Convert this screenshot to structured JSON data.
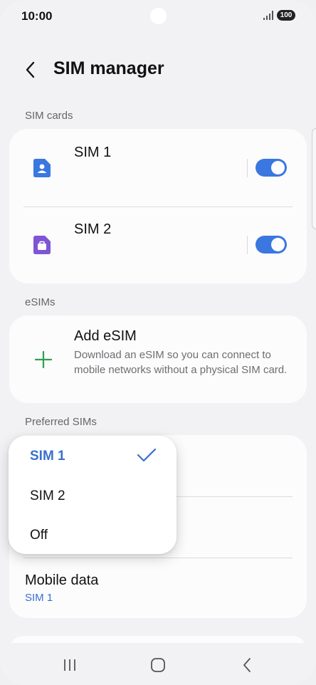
{
  "status_bar": {
    "time": "10:00",
    "battery": "100",
    "signal_icon": "signal-icon"
  },
  "header": {
    "title": "SIM manager",
    "back_icon": "back-arrow-icon"
  },
  "sections": {
    "sim_cards": "SIM cards",
    "esims": "eSIMs",
    "preferred_sims": "Preferred SIMs"
  },
  "sim_cards": [
    {
      "name": "SIM 1",
      "icon": "sim-person-icon",
      "icon_color": "#3a77e0",
      "enabled": true
    },
    {
      "name": "SIM 2",
      "icon": "sim-briefcase-icon",
      "icon_color": "#7e55d4",
      "enabled": true
    }
  ],
  "add_esim": {
    "title": "Add eSIM",
    "description": "Download an eSIM so you can connect to mobile networks without a physical SIM card.",
    "icon": "plus-icon",
    "icon_color": "#2fa04a"
  },
  "preferred": {
    "mobile_data_label": "Mobile data",
    "mobile_data_value": "SIM 1"
  },
  "dropdown": {
    "options": [
      "SIM 1",
      "SIM 2",
      "Off"
    ],
    "selected": "SIM 1",
    "check_icon": "checkmark-icon"
  },
  "nav_bar": {
    "recents_icon": "recents-icon",
    "home_icon": "home-icon",
    "back_icon": "back-icon"
  },
  "colors": {
    "accent": "#3a77e0",
    "link": "#3a6fd0",
    "background": "#f2f2f4",
    "card": "#fcfcfd"
  }
}
